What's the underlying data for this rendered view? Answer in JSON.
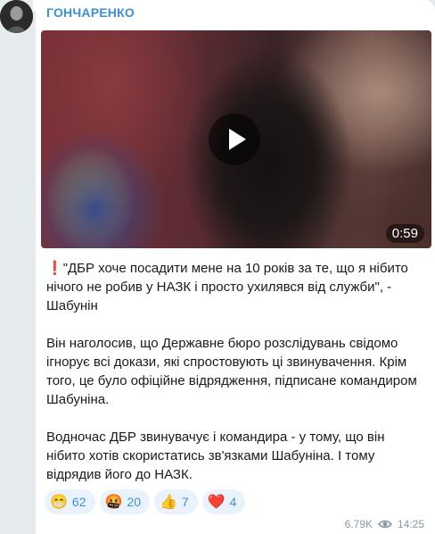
{
  "post": {
    "author": "ГОНЧАРЕНКО",
    "video_duration": "0:59",
    "paragraph1_icon": "❗",
    "paragraph1": "\"ДБР хоче посадити мене на 10 років за те, що я нібито нічого не робив у НАЗК і просто ухилявся від служби\", - Шабунін",
    "paragraph2": "Він наголосив, що Державне бюро розслідувань свідомо ігнорує всі докази, які спростовують ці звинувачення. Крім того, це було офіційне відрядження, підписане командиром Шабуніна.",
    "paragraph3": "Водночас ДБР звинувачує і командира - у тому, що він нібито хотів скористатись зв'язками Шабуніна. І тому відрядив його до НАЗК.",
    "reactions": [
      {
        "emoji": "😁",
        "count": "62"
      },
      {
        "emoji": "🤬",
        "count": "20"
      },
      {
        "emoji": "👍",
        "count": "7"
      },
      {
        "emoji": "❤️",
        "count": "4"
      }
    ],
    "views": "6.79K",
    "time": "14:25"
  },
  "colors": {
    "author": "#3d8fd6",
    "reaction_bg": "#eaf3fb",
    "meta": "#8a9aa6",
    "page_bg": "#e6ebee"
  }
}
